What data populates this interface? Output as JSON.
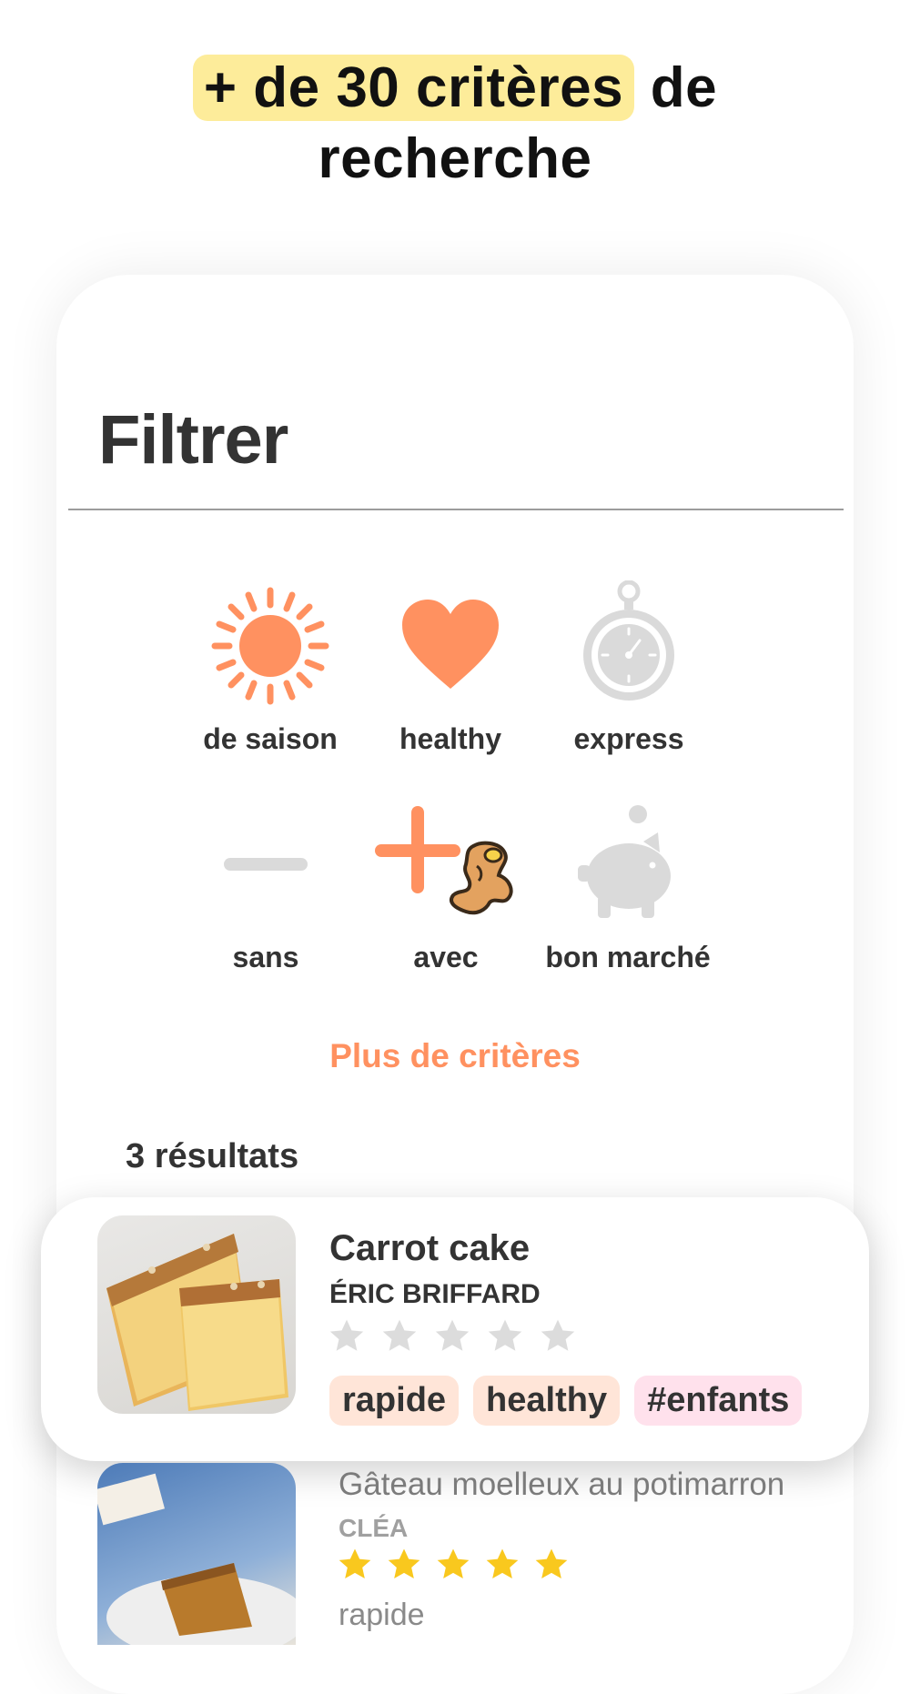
{
  "headline": {
    "highlight": "+ de 30 critères",
    "rest_line1": " de",
    "line2": "recherche"
  },
  "filter_screen": {
    "title": "Filtrer",
    "filters": [
      {
        "label": "de saison",
        "icon": "sun-icon",
        "active": true
      },
      {
        "label": "healthy",
        "icon": "heart-icon",
        "active": true
      },
      {
        "label": "express",
        "icon": "stopwatch-icon",
        "active": false
      },
      {
        "label": "sans",
        "icon": "minus-icon",
        "active": false
      },
      {
        "label": "avec",
        "icon": "plus-icon",
        "active": true,
        "ingredient_icon": "ginger-icon"
      },
      {
        "label": "bon marché",
        "icon": "piggy-bank-icon",
        "active": false
      }
    ],
    "more_label": "Plus de critères",
    "results_count": "3 résultats"
  },
  "results": [
    {
      "title": "Carrot cake",
      "author": "ÉRIC BRIFFARD",
      "rating": 0,
      "tags": [
        {
          "label": "rapide",
          "color": "#ffe5d8"
        },
        {
          "label": "healthy",
          "color": "#ffe5d8"
        },
        {
          "label": "#enfants",
          "color": "#ffe1ec"
        }
      ]
    },
    {
      "title": "Gâteau moelleux au potimarron",
      "author": "CLÉA",
      "rating": 5,
      "tags": [
        {
          "label": "rapide"
        }
      ]
    }
  ],
  "colors": {
    "accent": "#ff9160",
    "highlight": "#fdec9a",
    "star_active": "#f9c81e",
    "star_inactive": "#dcdcdc",
    "icon_inactive": "#d9d9d9"
  }
}
